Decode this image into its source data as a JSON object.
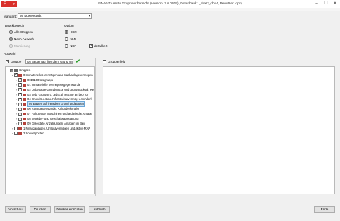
{
  "window": {
    "app_button_label": "F",
    "title": "FINANZ+  AnBu Gruppenübersicht (Version: 3.0.0305), Datenbank:          _nfo02_dbx4, Benutzer: dpc)",
    "minimize": "–",
    "maximize": "☐",
    "close": "✕"
  },
  "mandant": {
    "label": "Mandant:",
    "value": "66 Musterstadt"
  },
  "druckbereich": {
    "title": "Druckbereich",
    "options": [
      {
        "label": "Alle Gruppen",
        "selected": false,
        "enabled": true
      },
      {
        "label": "Nach Auswahl",
        "selected": true,
        "enabled": true
      },
      {
        "label": "Markierung",
        "selected": false,
        "enabled": false
      }
    ]
  },
  "option": {
    "title": "Option",
    "radios": [
      {
        "label": "HKR",
        "selected": true
      },
      {
        "label": "KLR",
        "selected": false
      },
      {
        "label": "NKF",
        "selected": false
      }
    ],
    "detailliert_label": "detailliert",
    "detailliert_checked": true
  },
  "auswahl": {
    "title": "Auswahl",
    "gruppe_label": "Gruppe",
    "gruppe_checked": true,
    "gruppe_value": "05 Bauten auf fremdem Grund und",
    "gruppenfeld_label": "Gruppenfeld"
  },
  "tree": [
    {
      "label": "Gruppen",
      "level": 0,
      "expander": "▾",
      "state": "partial",
      "root": true
    },
    {
      "label": "0 Immaterielles Vermögen und Sachanlagevermögen",
      "level": 1,
      "expander": "▾",
      "state": "checked"
    },
    {
      "label": "0019100 testgruppe",
      "level": 2,
      "expander": "›",
      "state": "checked"
    },
    {
      "label": "01 Immaterielle Vermögensgegenstände",
      "level": 2,
      "expander": "›",
      "state": "checked"
    },
    {
      "label": "02 Unbebaute Grundstücke und grundstücksgl. Re",
      "level": 2,
      "expander": "›",
      "state": "checked"
    },
    {
      "label": "03 Beb. Grundst u. grdst.gl. Rechte an beb. Gr",
      "level": 2,
      "expander": "›",
      "state": "checked"
    },
    {
      "label": "04 Grundst.u.Baut.Infrastrukturvermög u.Sonderl",
      "level": 2,
      "expander": "›",
      "state": "checked"
    },
    {
      "label": "05 Bauten auf fremdem Grund und Boden",
      "level": 2,
      "expander": "›",
      "state": "checked",
      "selected": true
    },
    {
      "label": "06 Kunstgegenstände, Kulturdenkmäler",
      "level": 2,
      "expander": "›",
      "state": "checked"
    },
    {
      "label": "07 Fahrzeuge, Maschinen und technische Anlage",
      "level": 2,
      "expander": "›",
      "state": "checked"
    },
    {
      "label": "08 Betriebs- und Geschäftsausstattung",
      "level": 2,
      "expander": "›",
      "state": "checked"
    },
    {
      "label": "09 Geleistete Anzahlungen, Anlagen im Bau",
      "level": 2,
      "expander": "›",
      "state": "checked"
    },
    {
      "label": "1 Finanzanlagen, Umlaufvermögen und aktive RAP",
      "level": 1,
      "expander": "›",
      "state": "unchecked"
    },
    {
      "label": "2 Sonderposten",
      "level": 1,
      "expander": "›",
      "state": "unchecked"
    }
  ],
  "buttons": {
    "vorschau": "Vorschau",
    "drucken": "Drucken",
    "drucker_einrichten": "Drucker einrichten",
    "abbruch": "Abbruch",
    "ende": "Ende"
  },
  "icons": {
    "confirm": "green-check-icon",
    "folder": "folder-icon"
  },
  "colors": {
    "app_button": "#d9302b",
    "folder": "#b5423b",
    "confirm": "#1a9a1a",
    "selection": "#cce4f7"
  }
}
